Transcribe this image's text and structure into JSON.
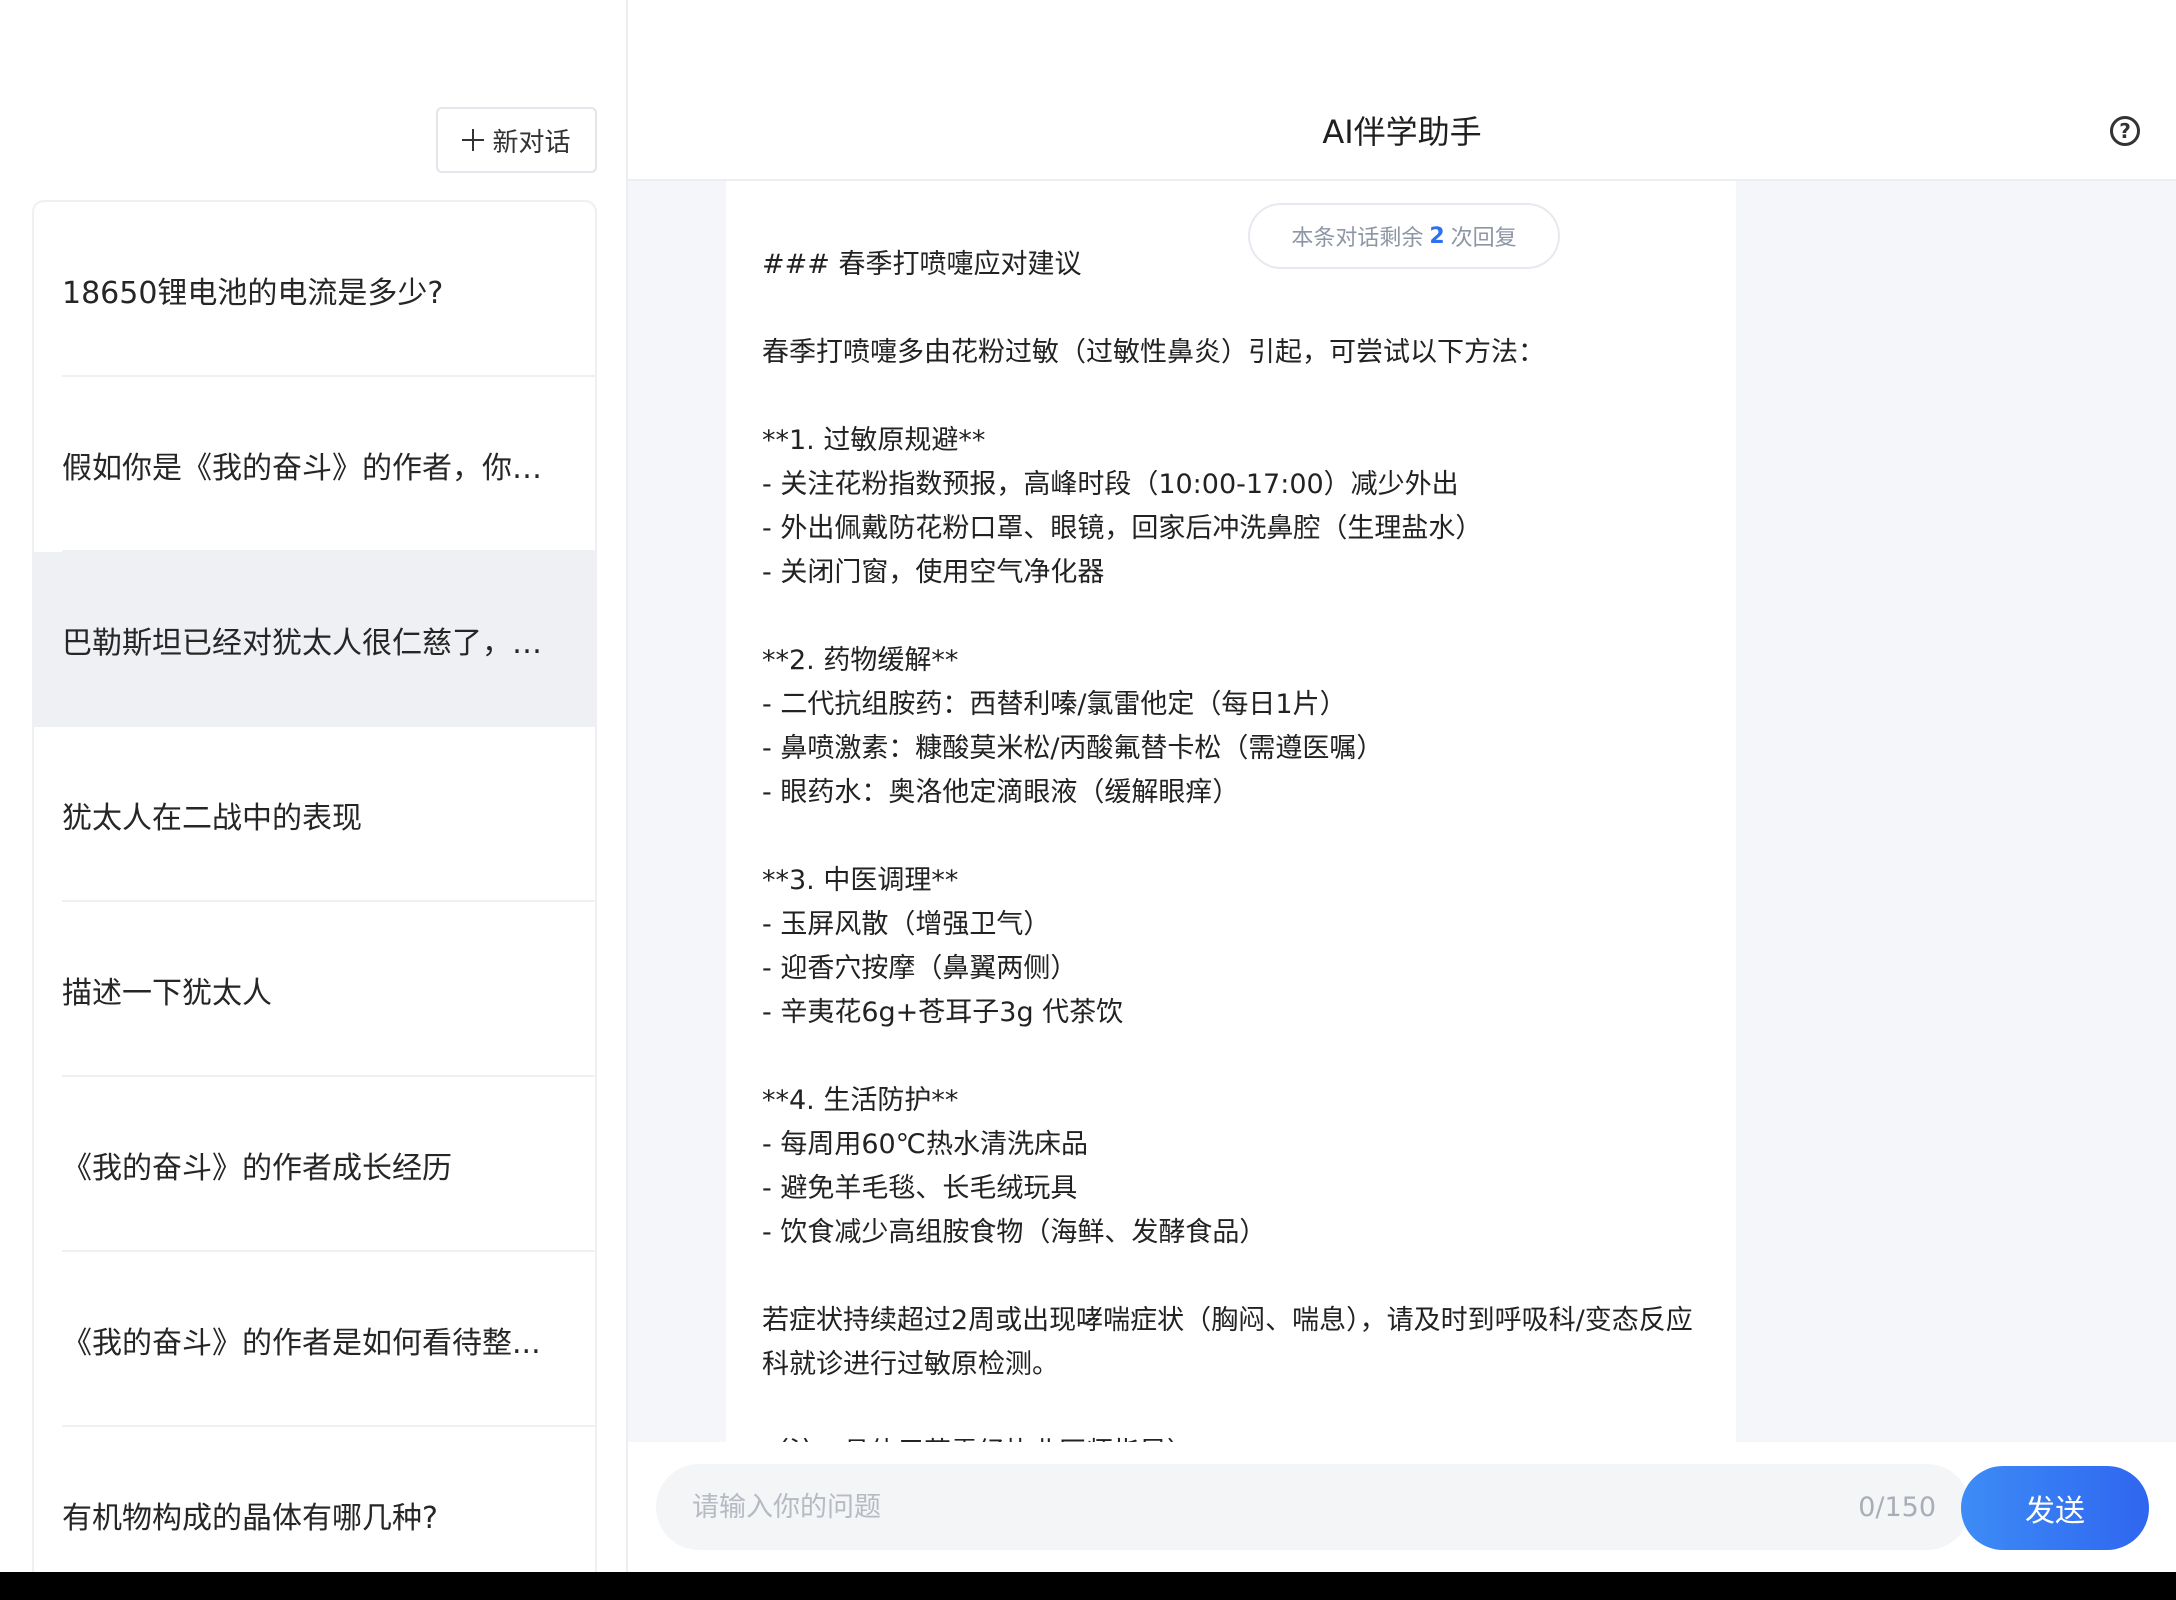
{
  "sidebar": {
    "new_chat_label": "新对话",
    "history": [
      {
        "label": "18650锂电池的电流是多少?"
      },
      {
        "label": "假如你是《我的奋斗》的作者，你会..."
      },
      {
        "label": "巴勒斯坦已经对犹太人很仁慈了，可...",
        "active": true
      },
      {
        "label": "犹太人在二战中的表现"
      },
      {
        "label": "描述一下犹太人"
      },
      {
        "label": "《我的奋斗》的作者成长经历"
      },
      {
        "label": "《我的奋斗》的作者是如何看待整..."
      },
      {
        "label": "有机物构成的晶体有哪几种?"
      }
    ]
  },
  "header": {
    "title": "AI伴学助手",
    "help_icon": "question-circle-icon"
  },
  "chat": {
    "remaining_prefix": "本条对话剩余",
    "remaining_count": "2",
    "remaining_suffix": "次回复",
    "message": "### 春季打喷嚏应对建议\n\n春季打喷嚏多由花粉过敏（过敏性鼻炎）引起，可尝试以下方法：\n\n**1. 过敏原规避**\n- 关注花粉指数预报，高峰时段（10:00-17:00）减少外出\n- 外出佩戴防花粉口罩、眼镜，回家后冲洗鼻腔（生理盐水）\n- 关闭门窗，使用空气净化器\n\n**2. 药物缓解**\n- 二代抗组胺药：西替利嗪/氯雷他定（每日1片）\n- 鼻喷激素：糠酸莫米松/丙酸氟替卡松（需遵医嘱）\n- 眼药水：奥洛他定滴眼液（缓解眼痒）\n\n**3. 中医调理**\n- 玉屏风散（增强卫气）\n- 迎香穴按摩（鼻翼两侧）\n- 辛夷花6g+苍耳子3g 代茶饮\n\n**4. 生活防护**\n- 每周用60℃热水清洗床品\n- 避免羊毛毯、长毛绒玩具\n- 饮食减少高组胺食物（海鲜、发酵食品）\n\n若症状持续超过2周或出现哮喘症状（胸闷、喘息），请及时到呼吸科/变态反应科就诊进行过敏原检测。\n\n（注：具体用药需经执业医师指导）"
  },
  "input": {
    "placeholder": "请输入你的问题",
    "value": "",
    "counter": "0/150",
    "send_label": "发送"
  }
}
